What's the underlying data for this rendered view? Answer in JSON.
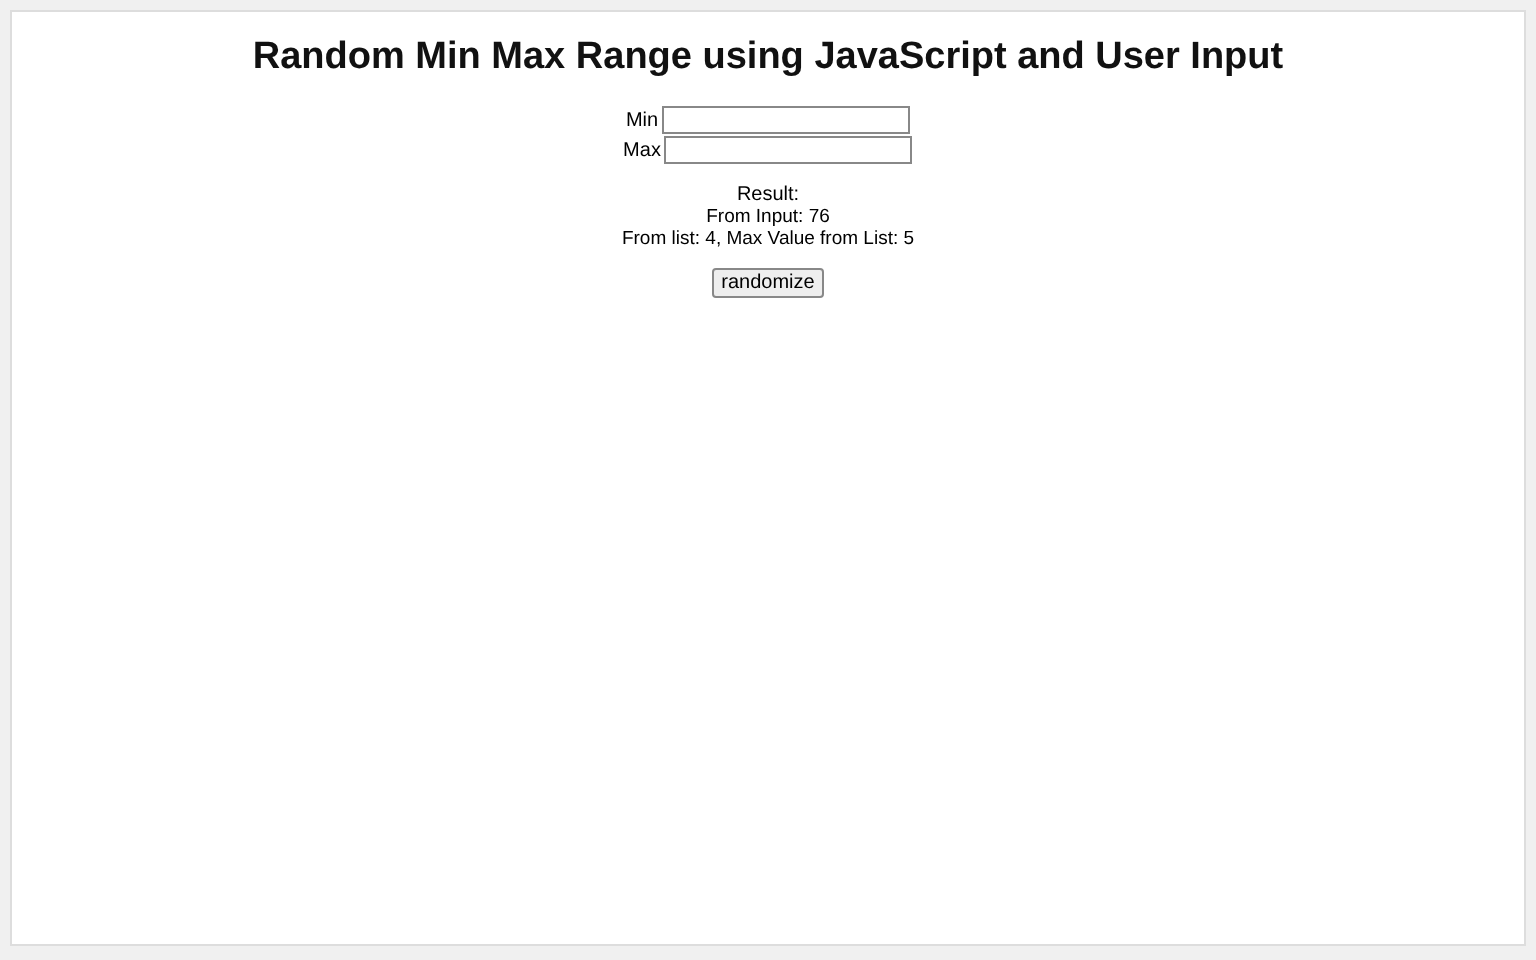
{
  "title": "Random Min Max Range using JavaScript and User Input",
  "fields": [
    {
      "label": "Min"
    },
    {
      "label": "Max"
    }
  ],
  "result": {
    "heading": "Result:",
    "from_input": "From Input: 76",
    "from_list": "From list: 4, Max Value from List: 5"
  },
  "button": "randomize"
}
